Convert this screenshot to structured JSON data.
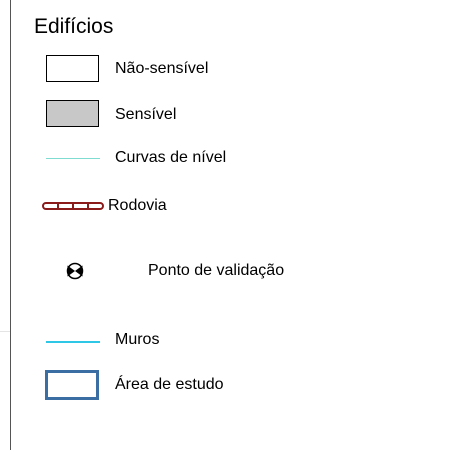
{
  "legend": {
    "title": "Edifícios",
    "items": [
      {
        "label": "Não-sensível",
        "symbol": "white-box"
      },
      {
        "label": "Sensível",
        "symbol": "gray-box"
      },
      {
        "label": "Curvas de nível",
        "symbol": "thin-line",
        "color": "#7fdcd0"
      },
      {
        "label": "Rodovia",
        "symbol": "road-line",
        "color": "#8b1a1a"
      },
      {
        "label": "Ponto de validação",
        "symbol": "point-icon"
      },
      {
        "label": "Muros",
        "symbol": "line",
        "color": "#2ec8e6"
      },
      {
        "label": "Área de estudo",
        "symbol": "outline-box",
        "color": "#3b6fa3"
      }
    ]
  }
}
